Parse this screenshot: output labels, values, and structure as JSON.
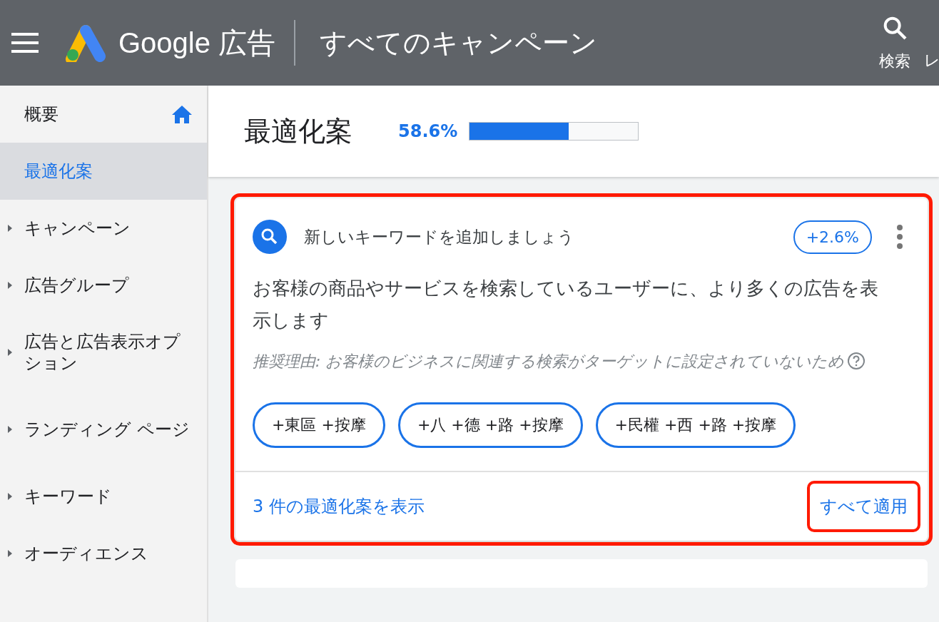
{
  "topbar": {
    "product": "Google 広告",
    "page_title": "すべてのキャンペーン",
    "actions": [
      {
        "label": "検索",
        "kind": "search"
      },
      {
        "label": "レ",
        "kind": "cut"
      }
    ]
  },
  "sidebar": {
    "items": [
      {
        "label": "概要",
        "kind": "home",
        "selected": false
      },
      {
        "label": "最適化案",
        "kind": "plain",
        "selected": true
      },
      {
        "label": "キャンペーン",
        "kind": "expandable",
        "selected": false
      },
      {
        "label": "広告グループ",
        "kind": "expandable",
        "selected": false
      },
      {
        "label": "広告と広告表示オプション",
        "kind": "expandable",
        "selected": false
      },
      {
        "label": "ランディング ページ",
        "kind": "expandable",
        "selected": false
      },
      {
        "label": "キーワード",
        "kind": "expandable",
        "selected": false
      },
      {
        "label": "オーディエンス",
        "kind": "expandable",
        "selected": false
      }
    ]
  },
  "header": {
    "title": "最適化案",
    "score": "58.6%",
    "level": 0.586
  },
  "card": {
    "highlighted": true,
    "title": "新しいキーワードを追加しましょう",
    "uplift": "+2.6%",
    "description": "お客様の商品やサービスを検索しているユーザーに、より多くの広告を表示します",
    "reason": "推奨理由: お客様のビジネスに関連する検索がターゲットに設定されていないため",
    "keywords": [
      "+東區 +按摩",
      "+八 +德 +路 +按摩",
      "+民權 +西 +路 +按摩"
    ],
    "view_link": "3 件の最適化案を表示",
    "apply_button": {
      "label": "すべて適用",
      "highlighted": true
    }
  }
}
